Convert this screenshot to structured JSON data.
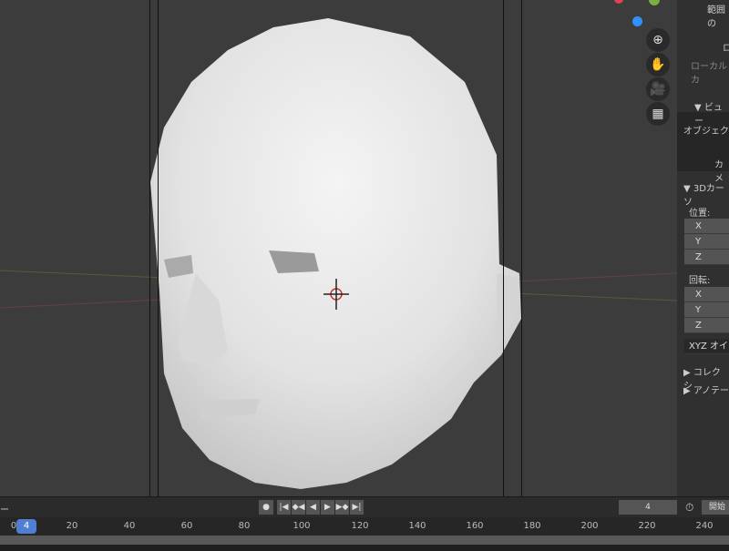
{
  "viewport": {
    "nav_icons": [
      "zoom-icon",
      "hand-pan-icon",
      "camera-icon",
      "grid-ortho-icon"
    ],
    "gizmo_colors": {
      "x": "#e04050",
      "y": "#7ab040",
      "z": "#3090ff"
    }
  },
  "n_panel": {
    "row1": "範囲の",
    "row2": "ロ",
    "row3": "ローカルカ",
    "view_section": "▼ ビュー",
    "object_label": "オブジェク",
    "camera_label": "カメ",
    "cursor_section": "▼ 3Dカーソ",
    "location_label": "位置:",
    "location": [
      "X",
      "Y",
      "Z"
    ],
    "rotation_label": "回転:",
    "rotation": [
      "X",
      "Y",
      "Z"
    ],
    "rotation_mode": "XYZ オイラ",
    "collection_section": "▶ コレクシ",
    "annotation_section": "▶ アノテー"
  },
  "timeline": {
    "editor_label": "ー",
    "playback_buttons": [
      "●",
      "|◀",
      "◆◀",
      "◀",
      "▶",
      "▶◆",
      "▶|"
    ],
    "current_frame": "4",
    "start_label": "開始",
    "ruler_start": "0",
    "ruler_ticks": [
      "20",
      "40",
      "60",
      "80",
      "100",
      "120",
      "140",
      "160",
      "180",
      "200",
      "220",
      "240"
    ],
    "playhead": "4"
  }
}
